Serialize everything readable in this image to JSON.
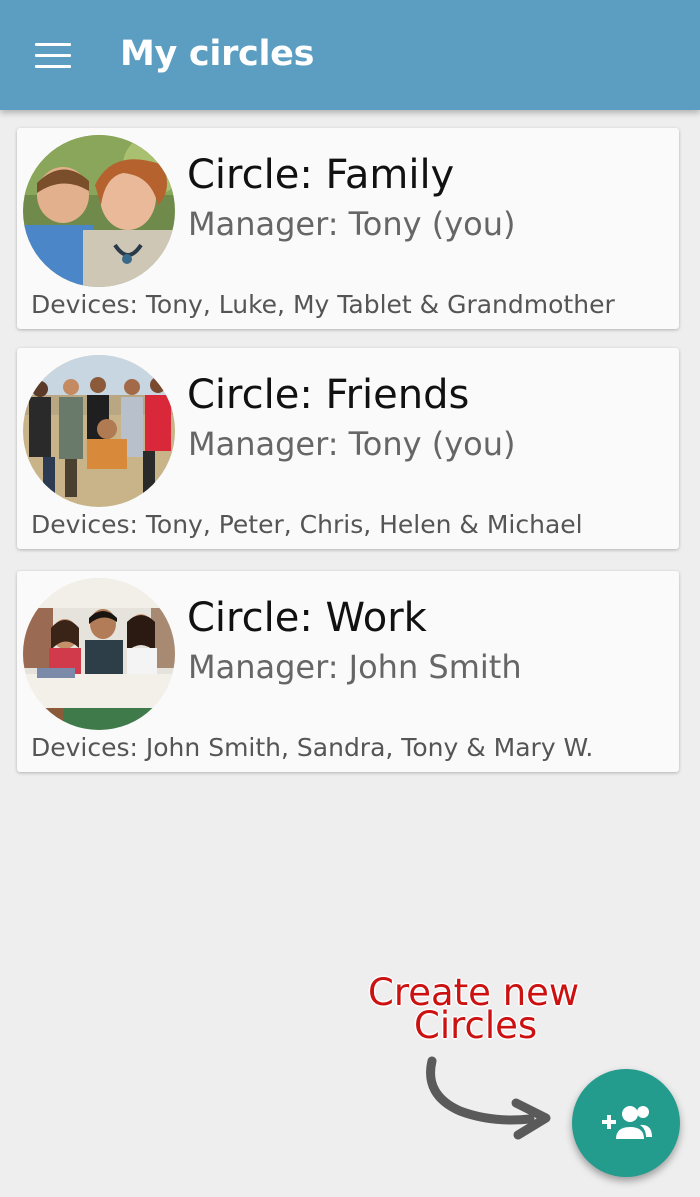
{
  "appbar": {
    "title": "My circles",
    "menu_icon": "hamburger-menu-icon",
    "color": "#5b9ec2"
  },
  "circles": [
    {
      "name": "Circle: Family",
      "manager": "Manager: Tony (you)",
      "devices": "Devices: Tony, Luke, My Tablet & Grandmother",
      "avatar": "family-photo"
    },
    {
      "name": "Circle: Friends",
      "manager": "Manager: Tony (you)",
      "devices": "Devices: Tony, Peter, Chris, Helen & Michael",
      "avatar": "friends-photo"
    },
    {
      "name": "Circle: Work",
      "manager": "Manager: John Smith",
      "devices": "Devices: John Smith, Sandra, Tony & Mary W.",
      "avatar": "work-photo"
    }
  ],
  "hint": {
    "line1": "Create new",
    "line2": "Circles",
    "color": "#cc1111"
  },
  "fab": {
    "icon": "add-group-icon",
    "color": "#239b8d"
  }
}
